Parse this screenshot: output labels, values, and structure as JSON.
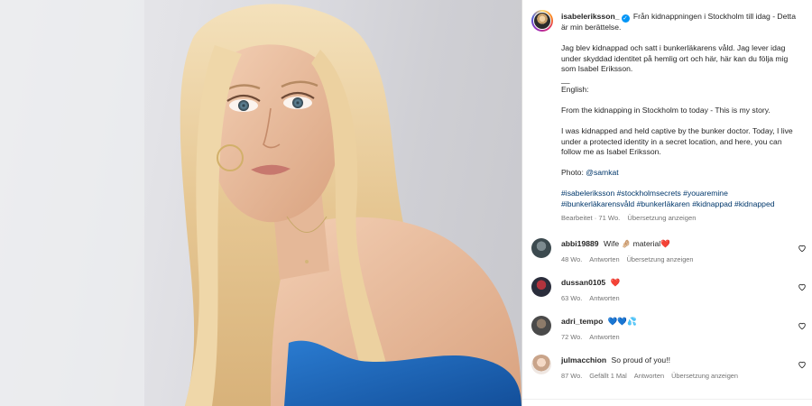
{
  "post": {
    "username": "isabeleriksson_",
    "caption_lines": [
      "Från kidnappningen i Stockholm till idag - Detta är min berättelse.",
      "",
      "Jag blev kidnappad och satt i bunkerläkarens våld. Jag lever idag under skyddad identitet på hemlig ort och här, här kan du följa mig som Isabel Eriksson.",
      "__",
      "English:",
      "",
      "From the kidnapping in Stockholm to today - This is my story.",
      "",
      "I was kidnapped and held captive by the bunker doctor. Today, I live under a protected identity in a secret location, and here, you can follow me as Isabel Eriksson.",
      ""
    ],
    "photo_label": "Photo:",
    "photo_credit": "@samkat",
    "hashtags": "#isabeleriksson #stockholmsecrets #youaremine #ibunkerläkarensvåld #bunkerläkaren #kidnappad #kidnapped",
    "edited": "Bearbeitet · 71 Wo.",
    "translate": "Übersetzung anzeigen"
  },
  "comments": [
    {
      "username": "abbi19889",
      "text": "Wife 🤌🏼 material",
      "emoji_suffix": "❤️",
      "age": "48 Wo.",
      "reply": "Antworten",
      "translate": "Übersetzung anzeigen",
      "likes": ""
    },
    {
      "username": "dussan0105",
      "text": "",
      "emoji_suffix": "❤️",
      "age": "63 Wo.",
      "reply": "Antworten",
      "translate": "",
      "likes": ""
    },
    {
      "username": "adri_tempo",
      "text": "💙💙",
      "emoji_suffix": "💦",
      "age": "72 Wo.",
      "reply": "Antworten",
      "translate": "",
      "likes": ""
    },
    {
      "username": "julmacchion",
      "text": "So proud of you!!",
      "emoji_suffix": "",
      "age": "87 Wo.",
      "reply": "Antworten",
      "translate": "Übersetzung anzeigen",
      "likes": "Gefällt 1 Mal"
    }
  ],
  "colors": {
    "link": "#00376b",
    "verified": "#0095f6",
    "dress": "#1f66b8",
    "hair": "#e9cf9e"
  },
  "icons": [
    "verified-badge-icon",
    "heart-outline-icon"
  ]
}
